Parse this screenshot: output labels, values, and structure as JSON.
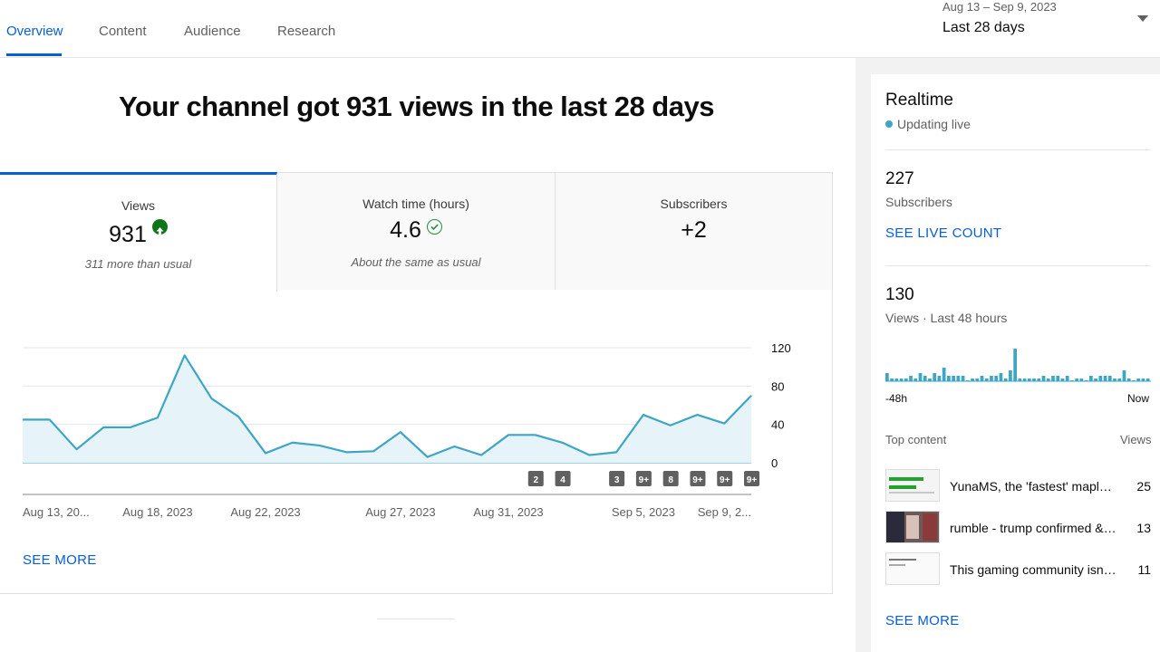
{
  "tabs": [
    {
      "label": "Overview",
      "active": true
    },
    {
      "label": "Content"
    },
    {
      "label": "Audience"
    },
    {
      "label": "Research"
    }
  ],
  "date_range": {
    "range": "Aug 13 – Sep 9, 2023",
    "label": "Last 28 days"
  },
  "headline": "Your channel got 931 views in the last 28 days",
  "metrics": [
    {
      "label": "Views",
      "value": "931",
      "note": "311 more than usual",
      "status_icon": "arrow-up-circle-icon"
    },
    {
      "label": "Watch time (hours)",
      "value": "4.6",
      "note": "About the same as usual",
      "status_icon": "check-circle-icon"
    },
    {
      "label": "Subscribers",
      "value": "+2"
    }
  ],
  "chart_data": {
    "type": "area",
    "series": [
      {
        "values": [
          45,
          45,
          14,
          37,
          37,
          47,
          112,
          67,
          48,
          10,
          21,
          18,
          11,
          12,
          32,
          6,
          17,
          8,
          29,
          29,
          21,
          8,
          11,
          50,
          39,
          50,
          41,
          70
        ]
      }
    ],
    "ylim": [
      0,
      120
    ],
    "yticks": [
      "120",
      "80",
      "40",
      "0"
    ],
    "xtick_labels": [
      "Aug 13, 20...",
      "Aug 18, 2023",
      "Aug 22, 2023",
      "Aug 27, 2023",
      "Aug 31, 2023",
      "Sep 5, 2023",
      "Sep 9, 2..."
    ],
    "markers": [
      "2",
      "4",
      "3",
      "9+",
      "8",
      "9+",
      "9+",
      "9+"
    ],
    "color": "#3ea6c4"
  },
  "see_more_label": "SEE MORE",
  "realtime": {
    "title": "Realtime",
    "status": "Updating live",
    "subscribers": "227",
    "subscribers_label": "Subscribers",
    "live_count_label": "SEE LIVE COUNT",
    "views": "130",
    "views_label": "Views · Last 48 hours",
    "bars": [
      3,
      1,
      1,
      1,
      1,
      2,
      1,
      3,
      2,
      1,
      3,
      2,
      5,
      2,
      2,
      2,
      2,
      0,
      1,
      1,
      2,
      1,
      2,
      2,
      3,
      1,
      4,
      12,
      1,
      1,
      1,
      1,
      1,
      2,
      1,
      2,
      2,
      1,
      2,
      0,
      1,
      1,
      0,
      2,
      1,
      2,
      2,
      2,
      1,
      1,
      4,
      1,
      0,
      1,
      1,
      1
    ],
    "axis_start": "-48h",
    "axis_end": "Now",
    "top_content_label": "Top content",
    "views_col_label": "Views",
    "top_content": [
      {
        "title": "YunaMS, the 'fastest' maples...",
        "views": "25"
      },
      {
        "title": "rumble - trump confirmed & r...",
        "views": "13"
      },
      {
        "title": "This gaming community isnt...",
        "views": "11"
      }
    ],
    "see_more_label": "SEE MORE"
  }
}
